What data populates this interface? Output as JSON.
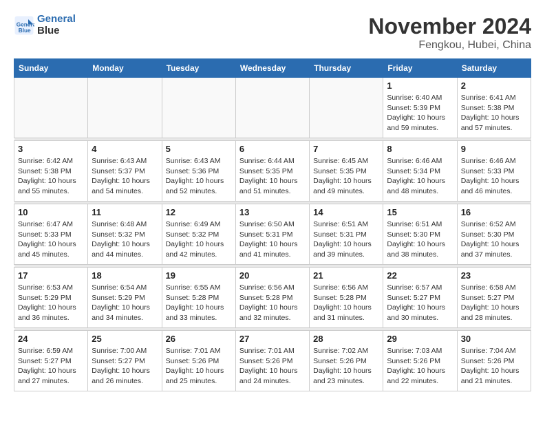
{
  "logo": {
    "line1": "General",
    "line2": "Blue"
  },
  "title": "November 2024",
  "subtitle": "Fengkou, Hubei, China",
  "days_of_week": [
    "Sunday",
    "Monday",
    "Tuesday",
    "Wednesday",
    "Thursday",
    "Friday",
    "Saturday"
  ],
  "weeks": [
    [
      {
        "day": "",
        "info": ""
      },
      {
        "day": "",
        "info": ""
      },
      {
        "day": "",
        "info": ""
      },
      {
        "day": "",
        "info": ""
      },
      {
        "day": "",
        "info": ""
      },
      {
        "day": "1",
        "info": "Sunrise: 6:40 AM\nSunset: 5:39 PM\nDaylight: 10 hours and 59 minutes."
      },
      {
        "day": "2",
        "info": "Sunrise: 6:41 AM\nSunset: 5:38 PM\nDaylight: 10 hours and 57 minutes."
      }
    ],
    [
      {
        "day": "3",
        "info": "Sunrise: 6:42 AM\nSunset: 5:38 PM\nDaylight: 10 hours and 55 minutes."
      },
      {
        "day": "4",
        "info": "Sunrise: 6:43 AM\nSunset: 5:37 PM\nDaylight: 10 hours and 54 minutes."
      },
      {
        "day": "5",
        "info": "Sunrise: 6:43 AM\nSunset: 5:36 PM\nDaylight: 10 hours and 52 minutes."
      },
      {
        "day": "6",
        "info": "Sunrise: 6:44 AM\nSunset: 5:35 PM\nDaylight: 10 hours and 51 minutes."
      },
      {
        "day": "7",
        "info": "Sunrise: 6:45 AM\nSunset: 5:35 PM\nDaylight: 10 hours and 49 minutes."
      },
      {
        "day": "8",
        "info": "Sunrise: 6:46 AM\nSunset: 5:34 PM\nDaylight: 10 hours and 48 minutes."
      },
      {
        "day": "9",
        "info": "Sunrise: 6:46 AM\nSunset: 5:33 PM\nDaylight: 10 hours and 46 minutes."
      }
    ],
    [
      {
        "day": "10",
        "info": "Sunrise: 6:47 AM\nSunset: 5:33 PM\nDaylight: 10 hours and 45 minutes."
      },
      {
        "day": "11",
        "info": "Sunrise: 6:48 AM\nSunset: 5:32 PM\nDaylight: 10 hours and 44 minutes."
      },
      {
        "day": "12",
        "info": "Sunrise: 6:49 AM\nSunset: 5:32 PM\nDaylight: 10 hours and 42 minutes."
      },
      {
        "day": "13",
        "info": "Sunrise: 6:50 AM\nSunset: 5:31 PM\nDaylight: 10 hours and 41 minutes."
      },
      {
        "day": "14",
        "info": "Sunrise: 6:51 AM\nSunset: 5:31 PM\nDaylight: 10 hours and 39 minutes."
      },
      {
        "day": "15",
        "info": "Sunrise: 6:51 AM\nSunset: 5:30 PM\nDaylight: 10 hours and 38 minutes."
      },
      {
        "day": "16",
        "info": "Sunrise: 6:52 AM\nSunset: 5:30 PM\nDaylight: 10 hours and 37 minutes."
      }
    ],
    [
      {
        "day": "17",
        "info": "Sunrise: 6:53 AM\nSunset: 5:29 PM\nDaylight: 10 hours and 36 minutes."
      },
      {
        "day": "18",
        "info": "Sunrise: 6:54 AM\nSunset: 5:29 PM\nDaylight: 10 hours and 34 minutes."
      },
      {
        "day": "19",
        "info": "Sunrise: 6:55 AM\nSunset: 5:28 PM\nDaylight: 10 hours and 33 minutes."
      },
      {
        "day": "20",
        "info": "Sunrise: 6:56 AM\nSunset: 5:28 PM\nDaylight: 10 hours and 32 minutes."
      },
      {
        "day": "21",
        "info": "Sunrise: 6:56 AM\nSunset: 5:28 PM\nDaylight: 10 hours and 31 minutes."
      },
      {
        "day": "22",
        "info": "Sunrise: 6:57 AM\nSunset: 5:27 PM\nDaylight: 10 hours and 30 minutes."
      },
      {
        "day": "23",
        "info": "Sunrise: 6:58 AM\nSunset: 5:27 PM\nDaylight: 10 hours and 28 minutes."
      }
    ],
    [
      {
        "day": "24",
        "info": "Sunrise: 6:59 AM\nSunset: 5:27 PM\nDaylight: 10 hours and 27 minutes."
      },
      {
        "day": "25",
        "info": "Sunrise: 7:00 AM\nSunset: 5:27 PM\nDaylight: 10 hours and 26 minutes."
      },
      {
        "day": "26",
        "info": "Sunrise: 7:01 AM\nSunset: 5:26 PM\nDaylight: 10 hours and 25 minutes."
      },
      {
        "day": "27",
        "info": "Sunrise: 7:01 AM\nSunset: 5:26 PM\nDaylight: 10 hours and 24 minutes."
      },
      {
        "day": "28",
        "info": "Sunrise: 7:02 AM\nSunset: 5:26 PM\nDaylight: 10 hours and 23 minutes."
      },
      {
        "day": "29",
        "info": "Sunrise: 7:03 AM\nSunset: 5:26 PM\nDaylight: 10 hours and 22 minutes."
      },
      {
        "day": "30",
        "info": "Sunrise: 7:04 AM\nSunset: 5:26 PM\nDaylight: 10 hours and 21 minutes."
      }
    ]
  ]
}
